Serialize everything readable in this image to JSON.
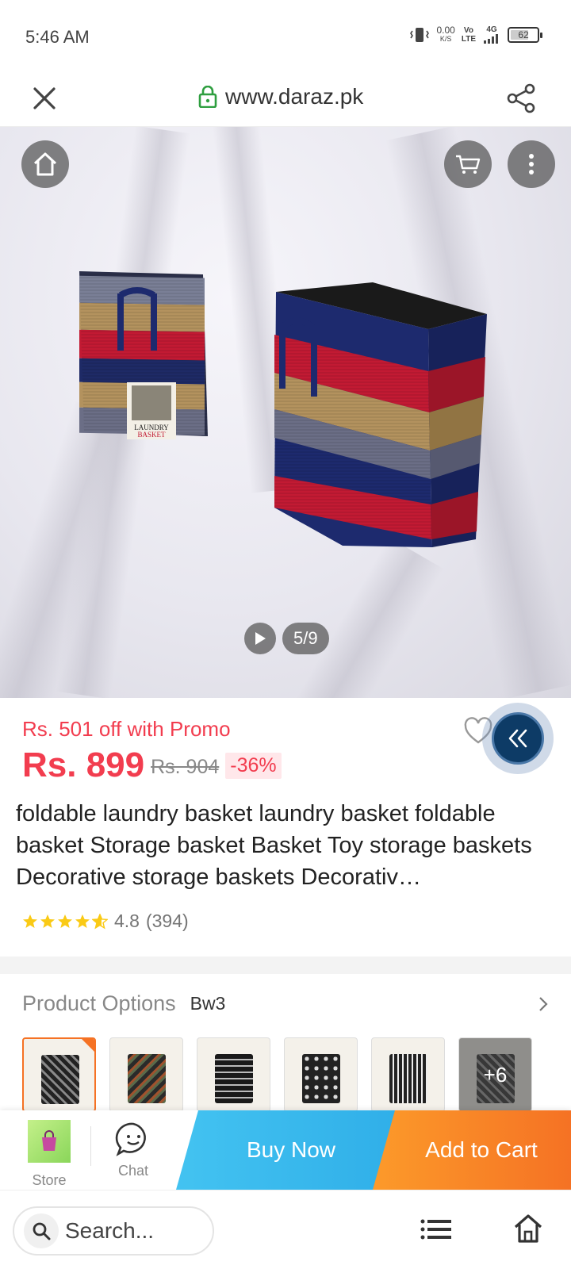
{
  "status_bar": {
    "time": "5:46 AM",
    "net_speed": "0.00",
    "net_unit": "K/S",
    "volte_top": "Vo",
    "volte_bottom": "LTE",
    "network": "4G",
    "battery": "62"
  },
  "browser": {
    "url": "www.daraz.pk",
    "search_placeholder": "Search..."
  },
  "hero": {
    "pager": "5/9",
    "box_label_line1": "LAUNDRY",
    "box_label_line2": "BASKET"
  },
  "product": {
    "promo": "Rs. 501 off with Promo",
    "price": "Rs. 899",
    "original_price": "Rs. 904",
    "discount": "-36%",
    "title": "foldable laundry basket laundry basket foldable basket Storage basket Basket Toy storage baskets Decorative storage baskets Decorativ…",
    "rating_value": 4.8,
    "rating": "4.8",
    "reviews": "(394)"
  },
  "options": {
    "label": "Product Options",
    "selected": "Bw3",
    "more": "+6"
  },
  "actions": {
    "store": "Store",
    "chat": "Chat",
    "buy_now": "Buy Now",
    "add_to_cart": "Add to Cart"
  },
  "colors": {
    "brand_orange": "#f57224",
    "price_red": "#f23d4f",
    "buy_blue": "#2faee8"
  }
}
